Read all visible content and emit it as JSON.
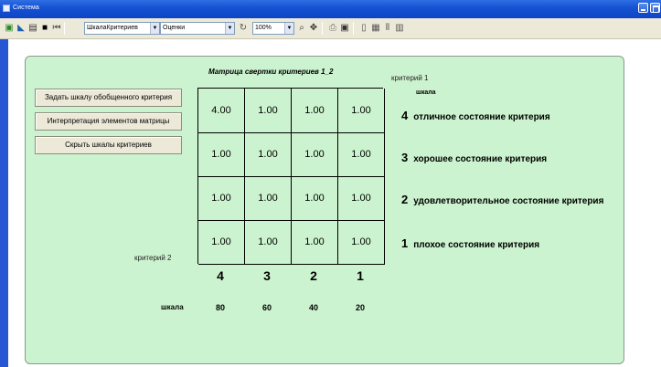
{
  "window": {
    "title": "Система"
  },
  "toolbar": {
    "combo1": "ШкалаКритериев",
    "combo2": "Оценки",
    "zoom": "100%"
  },
  "panel": {
    "buttons": {
      "set_scale": "Задать шкалу обобщенного критерия",
      "interpretation": "Интерпретация элементов матрицы",
      "hide_scales": "Скрыть шкалы критериев"
    },
    "matrix_title": "Матрица свертки критериев 1_2",
    "criterion1_label": "критерий 1",
    "criterion2_label": "критерий 2",
    "scale_header": "шкала",
    "matrix": [
      [
        "4.00",
        "1.00",
        "1.00",
        "1.00"
      ],
      [
        "1.00",
        "1.00",
        "1.00",
        "1.00"
      ],
      [
        "1.00",
        "1.00",
        "1.00",
        "1.00"
      ],
      [
        "1.00",
        "1.00",
        "1.00",
        "1.00"
      ]
    ],
    "levels": [
      {
        "num": "4",
        "text": "отличное состояние критерия"
      },
      {
        "num": "3",
        "text": "хорошее состояние критерия"
      },
      {
        "num": "2",
        "text": "удовлетворительное состояние критерия"
      },
      {
        "num": "1",
        "text": "плохое состояние критерия"
      }
    ],
    "column_numbers": [
      "4",
      "3",
      "2",
      "1"
    ],
    "scale_row_label": "шкала",
    "column_scales": [
      "80",
      "60",
      "40",
      "20"
    ]
  }
}
